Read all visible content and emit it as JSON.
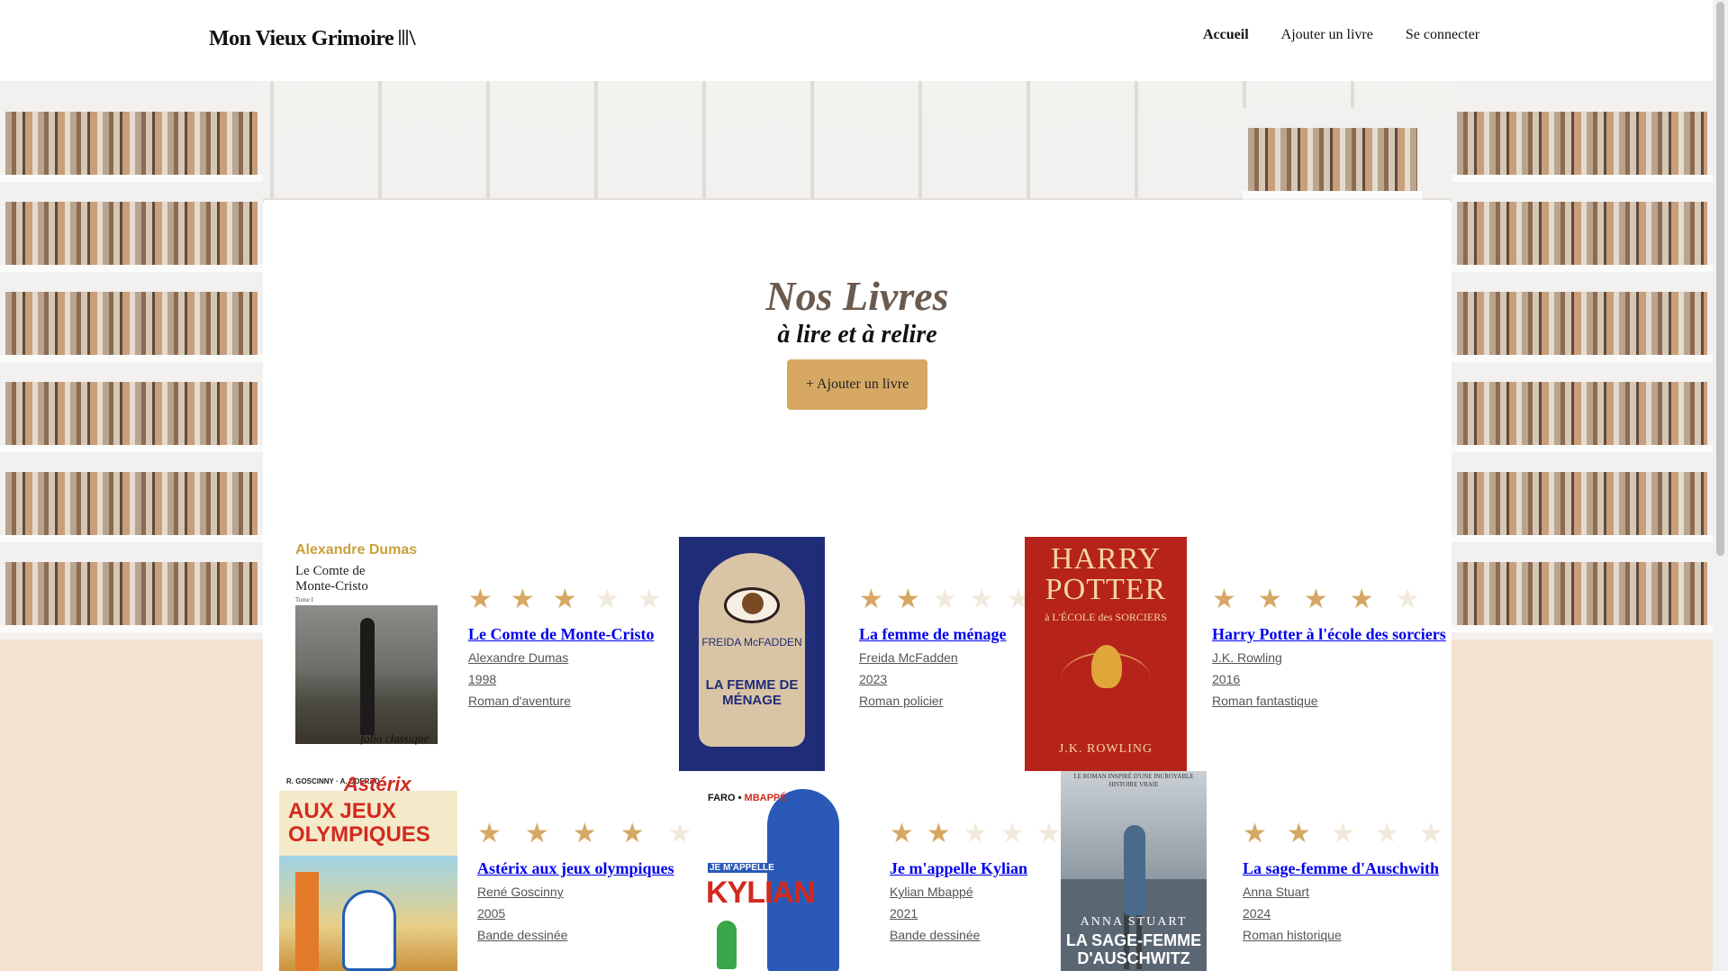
{
  "app": {
    "logo": "Mon Vieux Grimoire",
    "logo_icon": "books-icon"
  },
  "nav": {
    "items": [
      {
        "label": "Accueil",
        "active": true
      },
      {
        "label": "Ajouter un livre",
        "active": false
      },
      {
        "label": "Se connecter",
        "active": false
      }
    ]
  },
  "page": {
    "title": "Nos Livres",
    "subtitle": "à lire et à relire",
    "add_button": "+ Ajouter un livre"
  },
  "colors": {
    "accent": "#d6a864",
    "star_empty": "#f1e9dc",
    "link": "#0000ee",
    "page_bg": "#f3e2cf"
  },
  "books": [
    {
      "title": "Le Comte de Monte-Cristo",
      "author": "Alexandre Dumas",
      "year": "1998",
      "genre": "Roman d'aventure",
      "rating": 3,
      "cover": {
        "author": "Alexandre Dumas",
        "title": "Le Comte de Monte-Cristo",
        "tome": "Tome I",
        "publisher": "folio classique"
      }
    },
    {
      "title": "La femme de ménage",
      "author": "Freida McFadden",
      "year": "2023",
      "genre": "Roman policier",
      "rating": 2,
      "cover": {
        "author": "FREIDA McFADDEN",
        "title": "LA FEMME DE MÉNAGE"
      }
    },
    {
      "title": "Harry Potter à l'école des sorciers",
      "author": "J.K. Rowling",
      "year": "2016",
      "genre": "Roman fantastique",
      "rating": 4,
      "cover": {
        "title": "HARRY POTTER",
        "subtitle": "à L'ÉCOLE des SORCIERS",
        "author": "J.K. ROWLING"
      }
    },
    {
      "title": "Astérix aux jeux olympiques",
      "author": "René Goscinny",
      "year": "2005",
      "genre": "Bande dessinée",
      "rating": 4,
      "cover": {
        "authors": "R. GOSCINNY  ·  A. UDERZO",
        "series": "Astérix",
        "title": "AUX JEUX OLYMPIQUES"
      }
    },
    {
      "title": "Je m'appelle Kylian",
      "author": "Kylian Mbappé",
      "year": "2021",
      "genre": "Bande dessinée",
      "rating": 2,
      "cover": {
        "authors_a": "FARO •",
        "authors_b": "MBAPPÉ",
        "pre": "JE M'APPELLE",
        "title": "KYLIAN"
      }
    },
    {
      "title": "La sage-femme d'Auschwith",
      "author": "Anna Stuart",
      "year": "2024",
      "genre": "Roman historique",
      "rating": 2,
      "cover": {
        "tagline": "LE ROMAN INSPIRÉ D'UNE INCROYABLE HISTOIRE VRAIE",
        "author": "ANNA STUART",
        "title": "LA SAGE-FEMME D'AUSCHWITZ"
      }
    }
  ]
}
